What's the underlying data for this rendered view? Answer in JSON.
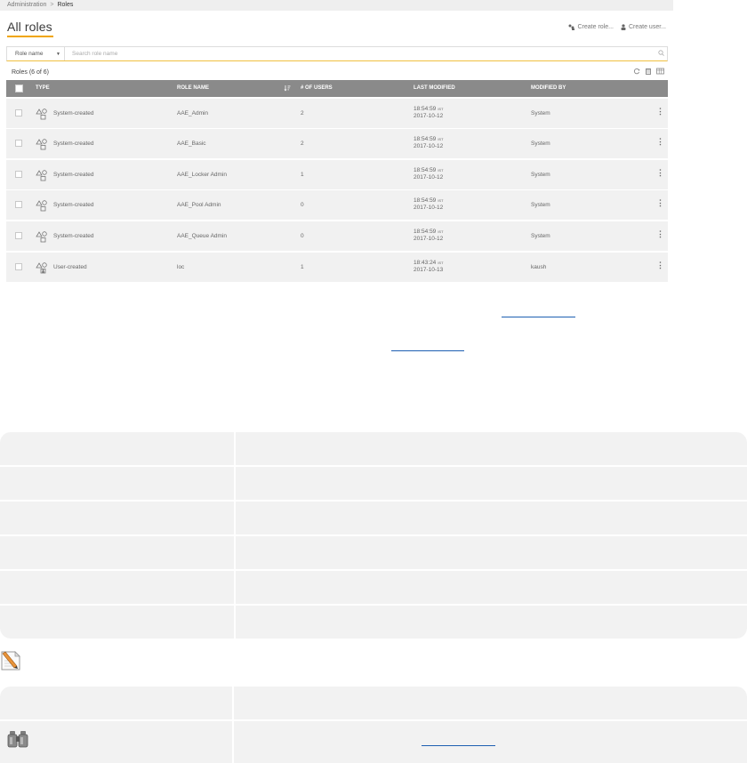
{
  "breadcrumb": {
    "parent": "Administration",
    "separator": ">",
    "current": "Roles"
  },
  "page": {
    "title": "All roles"
  },
  "header_actions": {
    "create_role": "Create role...",
    "create_user": "Create user..."
  },
  "search": {
    "field_select": "Role name",
    "placeholder": "Search role name"
  },
  "list": {
    "count_label": "Roles (6 of 6)"
  },
  "columns": {
    "type": "TYPE",
    "role_name": "ROLE NAME",
    "users": "# OF USERS",
    "last_modified": "LAST MODIFIED",
    "modified_by": "MODIFIED BY"
  },
  "rows": [
    {
      "type": "System-created",
      "role_name": "AAE_Admin",
      "users": "2",
      "time": "18:54:59",
      "tz": "IST",
      "date": "2017-10-12",
      "modified_by": "System"
    },
    {
      "type": "System-created",
      "role_name": "AAE_Basic",
      "users": "2",
      "time": "18:54:59",
      "tz": "IST",
      "date": "2017-10-12",
      "modified_by": "System"
    },
    {
      "type": "System-created",
      "role_name": "AAE_Locker Admin",
      "users": "1",
      "time": "18:54:59",
      "tz": "IST",
      "date": "2017-10-12",
      "modified_by": "System"
    },
    {
      "type": "System-created",
      "role_name": "AAE_Pool Admin",
      "users": "0",
      "time": "18:54:59",
      "tz": "IST",
      "date": "2017-10-12",
      "modified_by": "System"
    },
    {
      "type": "System-created",
      "role_name": "AAE_Queue Admin",
      "users": "0",
      "time": "18:54:59",
      "tz": "IST",
      "date": "2017-10-12",
      "modified_by": "System"
    },
    {
      "type": "User-created",
      "role_name": "loc",
      "users": "1",
      "time": "18:43:24",
      "tz": "IST",
      "date": "2017-10-13",
      "modified_by": "kaush"
    }
  ],
  "colors": {
    "accent": "#f0a500",
    "header_bg": "#8a8a8a",
    "row_bg": "#f1f1f1",
    "link": "#1d5fb2"
  }
}
